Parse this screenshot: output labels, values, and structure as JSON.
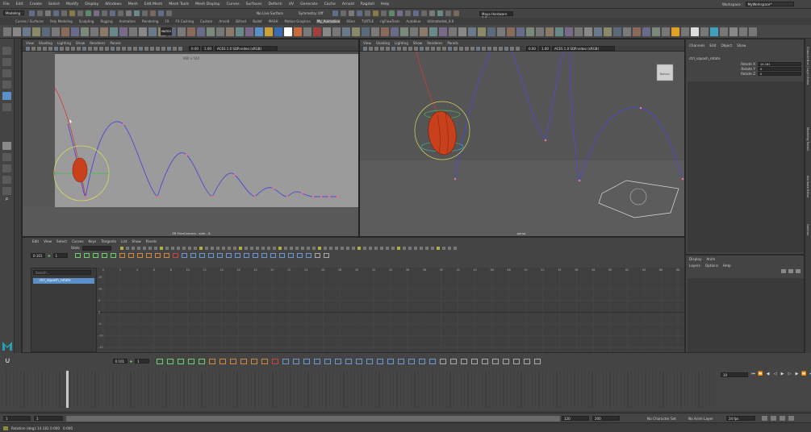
{
  "app": {
    "workspace_label": "Workspace :",
    "workspace_value": "MyWorkspace*"
  },
  "menubar": [
    "File",
    "Edit",
    "Create",
    "Select",
    "Modify",
    "Display",
    "Windows",
    "Mesh",
    "Edit Mesh",
    "Mesh Tools",
    "Mesh Display",
    "Curves",
    "Surfaces",
    "Deform",
    "UV",
    "Generate",
    "Cache",
    "Arnold",
    "Ragdoll",
    "Help"
  ],
  "statusline": {
    "mode": "Modeling",
    "live_surface": "No Live Surface",
    "symmetry": "Symmetry: Off",
    "search_field": "Maya Hardware 2.0"
  },
  "shelftabs": {
    "items": [
      "Curves / Surfaces",
      "Poly Modeling",
      "Sculpting",
      "Rigging",
      "Animation",
      "Rendering",
      "FX",
      "FX Caching",
      "Custom",
      "Arnold",
      "Bifrost",
      "Bullet",
      "MASH",
      "Motion Graphics",
      "My_Animation",
      "XGen",
      "TURTLE",
      "rigFlowTools",
      "Autoblue",
      "Ultimatedeb_9.0"
    ],
    "active": 14
  },
  "shelf": {
    "badge_text": "MATCH",
    "select_button": "Select",
    "set_label": "Set"
  },
  "viewport_left": {
    "menu": [
      "View",
      "Shading",
      "Lighting",
      "Show",
      "Renderer",
      "Panels"
    ],
    "exposure": "0.00",
    "gamma": "1.00",
    "colorspace": "ACES 1.0 SDR-video (sRGB)",
    "resolution_gate": "960 x 540",
    "camera_label": "ER FreeCamera - side - 8"
  },
  "viewport_right": {
    "menu": [
      "View",
      "Shading",
      "Lighting",
      "Show",
      "Renderer",
      "Panels"
    ],
    "exposure": "0.00",
    "gamma": "1.00",
    "colorspace": "ACES 1.0 SDR-video (sRGB)",
    "viewcube_label": "Bottom",
    "camera_label": "persp"
  },
  "channel_box": {
    "menu": [
      "Channels",
      "Edit",
      "Object",
      "Show"
    ],
    "object_name": "ctrl_squash_rotate",
    "attributes": [
      {
        "name": "Rotate X",
        "value": "14.181"
      },
      {
        "name": "Rotate Y",
        "value": "0"
      },
      {
        "name": "Rotate Z",
        "value": "0"
      }
    ],
    "side_tabs": [
      "Channel Box / Layer Editor",
      "Modeling Toolkit",
      "Attribute Editor",
      "Outliner"
    ]
  },
  "layer_editor": {
    "tabs": [
      "Display",
      "Anim"
    ],
    "menu": [
      "Layers",
      "Options",
      "Help"
    ]
  },
  "graph_editor": {
    "menu": [
      "Edit",
      "View",
      "Select",
      "Curves",
      "Keys",
      "Tangents",
      "List",
      "Show",
      "Panels"
    ],
    "stats_label": "Stats",
    "frame_field": "0.101",
    "value_field": "1",
    "search_placeholder": "Search...",
    "outliner_item": "ctrl_squash_rotate",
    "frame_ticks": [
      "0",
      "2",
      "4",
      "6",
      "8",
      "10",
      "12",
      "14",
      "16",
      "18",
      "20",
      "22",
      "24",
      "26",
      "28",
      "30",
      "32",
      "34",
      "36",
      "38",
      "40",
      "42",
      "44",
      "46",
      "48",
      "50",
      "52",
      "54",
      "56",
      "58",
      "60",
      "62",
      "64",
      "66",
      "68"
    ],
    "value_ticks": [
      "15",
      "10",
      "5",
      "0",
      "-5",
      "-10",
      "-15"
    ]
  },
  "dope_bar": {
    "frame_field": "0.101",
    "value_field": "1"
  },
  "timeslider": {
    "current_frame": "10"
  },
  "rangebar": {
    "start": "1",
    "start_inner": "1",
    "end_inner": "120",
    "end": "200",
    "character_set": "No Character Set",
    "anim_layer": "No Anim Layer",
    "fps": "24 fps"
  },
  "commandline": {
    "rotation_label": "Rotation (deg):",
    "rot_x": "14.181",
    "rot_y": "0.000",
    "rot_z": "0.000"
  },
  "colors": {
    "accent_blue": "#5a8fc8",
    "curve_blue": "#4b4ad0",
    "curve_red": "#d23a3a",
    "key_pink": "#f07090",
    "ball_orange": "#c8401c",
    "maya_logo": "#22a3b3"
  }
}
